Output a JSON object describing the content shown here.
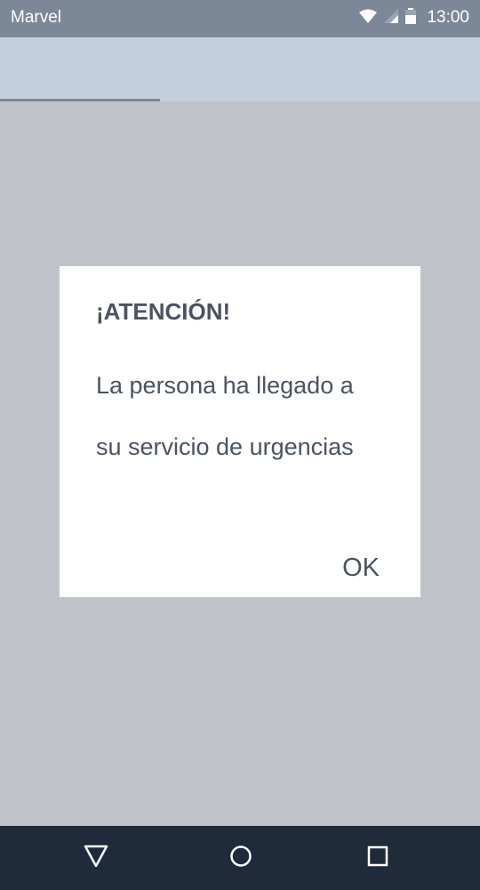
{
  "status_bar": {
    "carrier": "Marvel",
    "time": "13:00",
    "icons": [
      "wifi-icon",
      "signal-icon",
      "battery-icon"
    ]
  },
  "dialog": {
    "title": "¡ATENCIÓN!",
    "message": "La persona ha llegado a su servicio de urgencias",
    "ok_label": "OK"
  },
  "nav_bar": {
    "buttons": [
      "back-icon",
      "home-icon",
      "recents-icon"
    ]
  },
  "colors": {
    "status_bar": "#7c8797",
    "app_bar": "#c3cfdd",
    "scrim": "#c0c2c9",
    "dialog_text": "#4a5361",
    "nav_bar": "#1f2a3b"
  }
}
